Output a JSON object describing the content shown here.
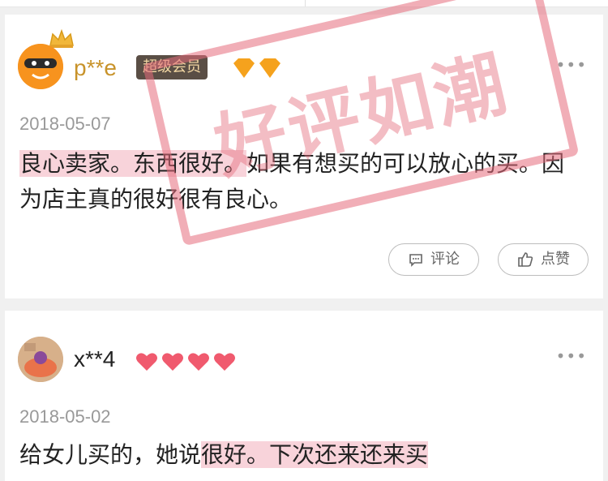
{
  "reviews": [
    {
      "username": "p**e",
      "badge": "超级会员",
      "date": "2018-05-07",
      "content_highlighted": "良心卖家。东西很好。",
      "content_rest": "如果有想买的可以放心的买。因为店主真的很好很有良心。",
      "rank_icon": "diamond-icon",
      "buttons": {
        "comment": "评论",
        "like": "点赞"
      }
    },
    {
      "username": "x**4",
      "date": "2018-05-02",
      "content_prefix": "给女儿买的，她说",
      "content_highlighted": "很好。下次还来还来买",
      "rank_icon": "heart-icon"
    }
  ],
  "stamp": {
    "text": "好评如潮"
  },
  "colors": {
    "highlight": "#f8d3da",
    "badge_bg": "#5a4e45",
    "badge_text": "#f3d7a3",
    "stamp": "#e56c7c"
  }
}
